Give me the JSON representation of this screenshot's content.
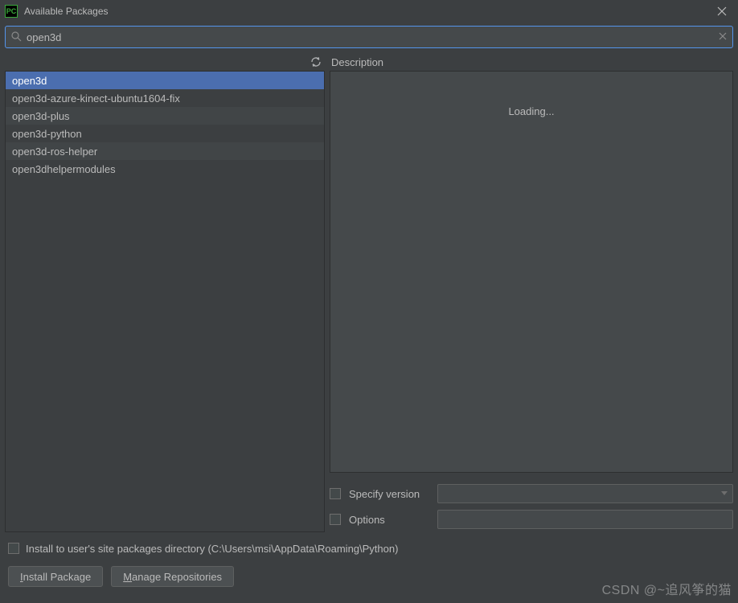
{
  "window": {
    "app_badge": "PC",
    "title": "Available Packages"
  },
  "search": {
    "value": "open3d"
  },
  "packages": [
    {
      "name": "open3d",
      "selected": true
    },
    {
      "name": "open3d-azure-kinect-ubuntu1604-fix",
      "selected": false
    },
    {
      "name": "open3d-plus",
      "selected": false
    },
    {
      "name": "open3d-python",
      "selected": false
    },
    {
      "name": "open3d-ros-helper",
      "selected": false
    },
    {
      "name": "open3dhelpermodules",
      "selected": false
    }
  ],
  "description": {
    "label": "Description",
    "status": "Loading..."
  },
  "options": {
    "specify_version_label": "Specify version",
    "version_value": "",
    "options_label": "Options",
    "options_value": ""
  },
  "site_packages": {
    "label": "Install to user's site packages directory (C:\\Users\\msi\\AppData\\Roaming\\Python)"
  },
  "buttons": {
    "install_prefix": "I",
    "install_rest": "nstall Package",
    "manage_prefix": "M",
    "manage_rest": "anage Repositories"
  },
  "watermark": "CSDN @~追风筝的猫"
}
